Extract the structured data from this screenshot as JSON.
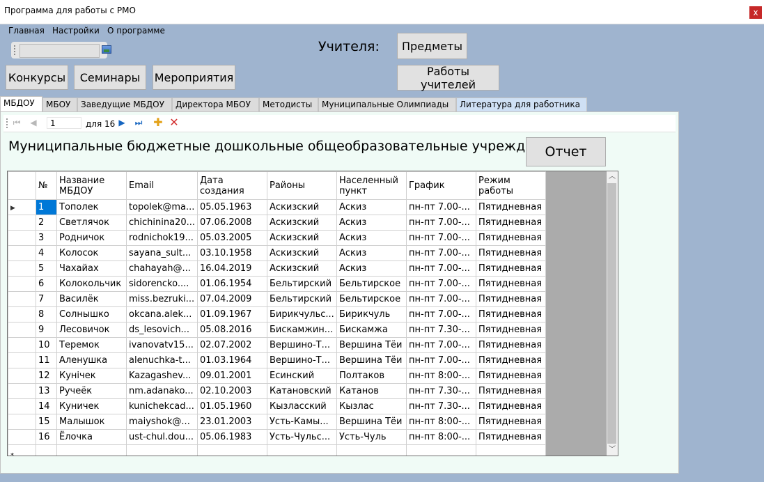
{
  "window": {
    "title": "Программа для работы с РМО",
    "close_label": "x"
  },
  "menu": [
    "Главная",
    "Настройки",
    "О программе"
  ],
  "teachers_label": "Учителя:",
  "buttons": {
    "contests": "Конкурсы",
    "seminars": "Семинары",
    "events": "Мероприятия",
    "subjects": "Предметы",
    "teacher_works": "Работы учителей",
    "report": "Отчет"
  },
  "tabs": [
    "МБДОУ",
    "МБОУ",
    "Заведущие МБДОУ",
    "Директора МБОУ",
    "Методисты",
    "Муниципальные Олимпиады",
    "Литература для работника"
  ],
  "active_tab": "МБДОУ",
  "navigator": {
    "position": "1",
    "count_text": "для 16"
  },
  "heading": "Муниципальные бюджетные дошкольные общеобразовательные учреждения",
  "table": {
    "columns": [
      "№",
      "Название МБДОУ",
      "Email",
      "Дата создания",
      "Районы",
      "Населенный пункт",
      "График",
      "Режим работы"
    ],
    "rows": [
      [
        "1",
        "Тополек",
        "topolek@ma...",
        "05.05.1963",
        "Аскизский",
        "Аскиз",
        "пн-пт 7.00-...",
        "Пятидневная"
      ],
      [
        "2",
        "Светлячок",
        "chichinina20...",
        "07.06.2008",
        "Аскизский",
        "Аскиз",
        "пн-пт 7.00-...",
        "Пятидневная"
      ],
      [
        "3",
        "Родничок",
        "rodnichok19...",
        "05.03.2005",
        "Аскизский",
        "Аскиз",
        "пн-пт 7.00-...",
        "Пятидневная"
      ],
      [
        "4",
        "Колосок",
        "sayana_sult...",
        "03.10.1958",
        "Аскизский",
        "Аскиз",
        "пн-пт 7.00-...",
        "Пятидневная"
      ],
      [
        "5",
        "Чахайах",
        "chahayah@...",
        "16.04.2019",
        "Аскизский",
        "Аскиз",
        "пн-пт 7.00-...",
        "Пятидневная"
      ],
      [
        "6",
        "Колокольчик",
        "sidorencko....",
        "01.06.1954",
        "Бельтирский",
        "Бельтирское",
        "пн-пт 7.00-...",
        "Пятидневная"
      ],
      [
        "7",
        "Василёк",
        "miss.bezruki...",
        "07.04.2009",
        "Бельтирский",
        "Бельтирское",
        "пн-пт 7.00-...",
        "Пятидневная"
      ],
      [
        "8",
        "Солнышко",
        "okcana.alek...",
        "01.09.1967",
        "Бирикчульс...",
        "Бирикчуль",
        "пн-пт 7.00-...",
        "Пятидневная"
      ],
      [
        "9",
        "Лесовичок",
        "ds_lesovich...",
        "05.08.2016",
        "Бискамжин...",
        "Бискамжа",
        "пн-пт 7.30-...",
        "Пятидневная"
      ],
      [
        "10",
        "Теремок",
        "ivanovatv15...",
        "02.07.2002",
        "Вершино-Т...",
        "Вершина Тёи",
        "пн-пт 7.00-...",
        "Пятидневная"
      ],
      [
        "11",
        "Аленушка",
        "alenuchka-t...",
        "01.03.1964",
        "Вершино-Т...",
        "Вершина Тёи",
        "пн-пт 7.00-...",
        "Пятидневная"
      ],
      [
        "12",
        "Кунічек",
        "Kazagashev...",
        "09.01.2001",
        "Есинский",
        "Полтаков",
        "пн-пт 8:00-...",
        "Пятидневная"
      ],
      [
        "13",
        "Ручеёк",
        "nm.adanako...",
        "02.10.2003",
        "Катановский",
        "Катанов",
        "пн-пт 7.30-...",
        "Пятидневная"
      ],
      [
        "14",
        "Куничек",
        "kunichekcad...",
        "01.05.1960",
        "Кызласский",
        "Кызлас",
        "пн-пт 7.30-...",
        "Пятидневная"
      ],
      [
        "15",
        "Малышок",
        "maiyshok@...",
        "23.01.2003",
        "Усть-Камы...",
        "Вершина Тёи",
        "пн-пт 8:00-...",
        "Пятидневная"
      ],
      [
        "16",
        "Ёлочка",
        "ust-chul.dou...",
        "05.06.1983",
        "Усть-Чульс...",
        "Усть-Чуль",
        "пн-пт 8:00-...",
        "Пятидневная"
      ]
    ],
    "new_row_marker": "*"
  }
}
